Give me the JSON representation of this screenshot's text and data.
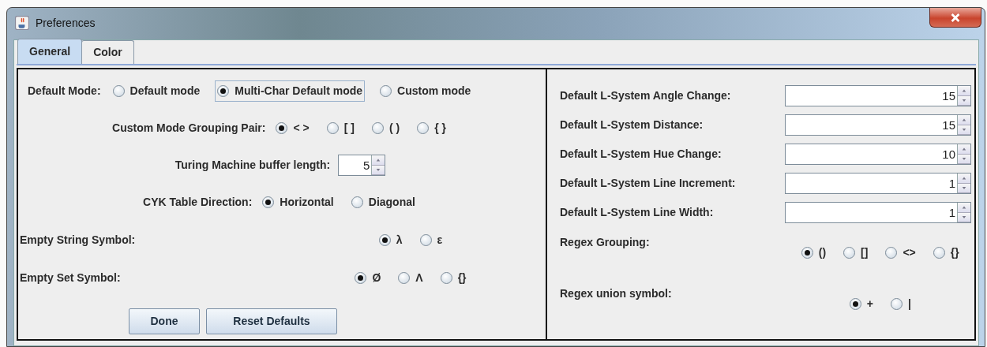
{
  "window": {
    "title": "Preferences"
  },
  "tabs": [
    {
      "label": "General",
      "selected": true
    },
    {
      "label": "Color",
      "selected": false
    }
  ],
  "left_panel": {
    "rows": [
      {
        "kind": "radio-inline",
        "label": "Default Mode:",
        "options": [
          {
            "label": "Default mode",
            "selected": false,
            "focused": false
          },
          {
            "label": "Multi-Char Default mode",
            "selected": true,
            "focused": true
          },
          {
            "label": "Custom mode",
            "selected": false,
            "focused": false
          }
        ]
      },
      {
        "kind": "radio-centered",
        "label": "Custom Mode Grouping Pair:",
        "options": [
          {
            "label": "< >",
            "selected": true,
            "focused": false
          },
          {
            "label": "[ ]",
            "selected": false,
            "focused": false
          },
          {
            "label": "( )",
            "selected": false,
            "focused": false
          },
          {
            "label": "{ }",
            "selected": false,
            "focused": false
          }
        ]
      },
      {
        "kind": "spinner-centered",
        "label": "Turing Machine buffer length:",
        "value": "5"
      },
      {
        "kind": "radio-centered",
        "label": "CYK Table Direction:",
        "options": [
          {
            "label": "Horizontal",
            "selected": true,
            "focused": false
          },
          {
            "label": "Diagonal",
            "selected": false,
            "focused": false
          }
        ]
      },
      {
        "kind": "radio-split",
        "label": "Empty String Symbol:",
        "options": [
          {
            "label": "λ",
            "selected": true,
            "focused": false
          },
          {
            "label": "ε",
            "selected": false,
            "focused": false
          }
        ]
      },
      {
        "kind": "radio-split",
        "label": "Empty Set Symbol:",
        "options": [
          {
            "label": "Ø",
            "selected": true,
            "focused": false
          },
          {
            "label": "Λ",
            "selected": false,
            "focused": false
          },
          {
            "label": "{}",
            "selected": false,
            "focused": false
          }
        ]
      }
    ],
    "buttons": [
      "Done",
      "Reset Defaults"
    ]
  },
  "right_panel": {
    "rows": [
      {
        "kind": "spinner-wide",
        "label": "Default L-System Angle Change:",
        "value": "15"
      },
      {
        "kind": "spinner-wide",
        "label": "Default L-System Distance:",
        "value": "15"
      },
      {
        "kind": "spinner-wide",
        "label": "Default L-System Hue Change:",
        "value": "10"
      },
      {
        "kind": "spinner-wide",
        "label": "Default L-System Line Increment:",
        "value": "1"
      },
      {
        "kind": "spinner-wide",
        "label": "Default L-System Line Width:",
        "value": "1"
      },
      {
        "kind": "radio-split",
        "label": "Regex Grouping:",
        "options": [
          {
            "label": "()",
            "selected": true,
            "focused": false
          },
          {
            "label": "[]",
            "selected": false,
            "focused": false
          },
          {
            "label": "<>",
            "selected": false,
            "focused": false
          },
          {
            "label": "{}",
            "selected": false,
            "focused": false
          }
        ]
      },
      {
        "kind": "radio-split",
        "label": "Regex union symbol:",
        "options": [
          {
            "label": "+",
            "selected": true,
            "focused": false
          },
          {
            "label": "|",
            "selected": false,
            "focused": false
          }
        ]
      }
    ]
  }
}
